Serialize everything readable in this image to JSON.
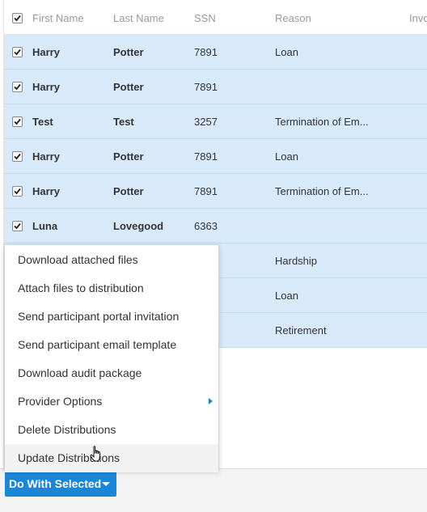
{
  "grid": {
    "headers": {
      "first_name": "First Name",
      "last_name": "Last Name",
      "ssn": "SSN",
      "reason": "Reason",
      "invoice": "Invo"
    },
    "select_all_checked": true,
    "rows": [
      {
        "checked": true,
        "first_name": "Harry",
        "last_name": "Potter",
        "ssn": "7891",
        "reason": "Loan"
      },
      {
        "checked": true,
        "first_name": "Harry",
        "last_name": "Potter",
        "ssn": "7891",
        "reason": ""
      },
      {
        "checked": true,
        "first_name": "Test",
        "last_name": "Test",
        "ssn": "3257",
        "reason": "Termination of Em..."
      },
      {
        "checked": true,
        "first_name": "Harry",
        "last_name": "Potter",
        "ssn": "7891",
        "reason": "Loan"
      },
      {
        "checked": true,
        "first_name": "Harry",
        "last_name": "Potter",
        "ssn": "7891",
        "reason": "Termination of Em..."
      },
      {
        "checked": true,
        "first_name": "Luna",
        "last_name": "Lovegood",
        "ssn": "6363",
        "reason": ""
      },
      {
        "checked": true,
        "first_name": "",
        "last_name": "",
        "ssn": "",
        "reason": "Hardship"
      },
      {
        "checked": true,
        "first_name": "",
        "last_name": "",
        "ssn": "",
        "reason": "Loan"
      },
      {
        "checked": true,
        "first_name": "",
        "last_name": "",
        "ssn": "",
        "reason": "Retirement"
      }
    ]
  },
  "menu": {
    "items": [
      {
        "label": "Download attached files"
      },
      {
        "label": "Attach files to distribution"
      },
      {
        "label": "Send participant portal invitation"
      },
      {
        "label": "Send participant email template"
      },
      {
        "label": "Download audit package"
      },
      {
        "label": "Provider Options",
        "has_submenu": true
      },
      {
        "label": "Delete Distributions"
      },
      {
        "label": "Update Distributions",
        "hovered": true
      }
    ]
  },
  "action_button": {
    "label": "Do With Selected",
    "icon": "caret-down-icon"
  },
  "colors": {
    "row_selected": "#d8eafa",
    "accent": "#1a86d8",
    "menu_hover": "#f2f2f2"
  }
}
